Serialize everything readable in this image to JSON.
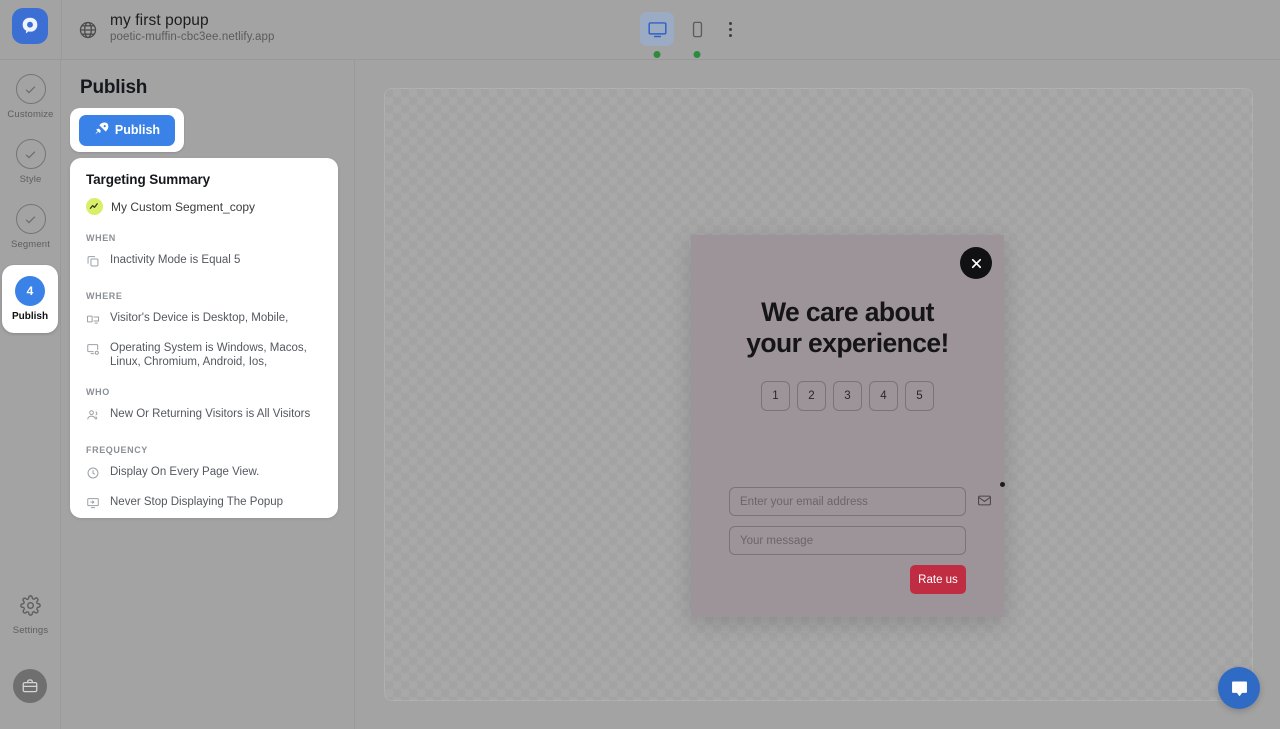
{
  "header": {
    "logo_icon": "popupsmart-logo-icon",
    "globe_icon": "globe-icon",
    "title": "my first popup",
    "url": "poetic-muffin-cbc3ee.netlify.app",
    "devices": [
      {
        "name": "desktop",
        "icon": "desktop-icon",
        "active": true,
        "status": "online"
      },
      {
        "name": "mobile",
        "icon": "mobile-icon",
        "active": false,
        "status": "online"
      }
    ],
    "menu_icon": "kebab-menu-icon",
    "active_color": "#3b6fd4",
    "status_dot_color": "#2e8b3d"
  },
  "rail": {
    "steps": [
      {
        "label": "Customize",
        "icon": "check-icon",
        "state": "complete"
      },
      {
        "label": "Style",
        "icon": "check-icon",
        "state": "complete"
      },
      {
        "label": "Segment",
        "icon": "check-icon",
        "state": "complete"
      }
    ],
    "active_step": {
      "number": "4",
      "label": "Publish",
      "color": "#3b82e8"
    },
    "settings": {
      "label": "Settings",
      "icon": "gear-icon"
    },
    "bag": {
      "icon": "briefcase-icon"
    }
  },
  "panel": {
    "title": "Publish",
    "publish_button": {
      "label": "Publish",
      "icon": "rocket-icon",
      "color": "#3b82e8"
    },
    "summary": {
      "title": "Targeting Summary",
      "segment": {
        "name": "My Custom Segment_copy",
        "icon": "trend-line-icon",
        "chip_color": "#d8ef6a"
      },
      "sections": [
        {
          "heading": "WHEN",
          "rules": [
            {
              "icon": "copy-icon",
              "text": "Inactivity Mode is Equal 5"
            }
          ]
        },
        {
          "heading": "WHERE",
          "rules": [
            {
              "icon": "device-icon",
              "text": "Visitor's Device is Desktop, Mobile,"
            },
            {
              "icon": "monitor-settings-icon",
              "text": "Operating System is Windows, Macos, Linux, Chromium, Android, Ios,"
            }
          ]
        },
        {
          "heading": "WHO",
          "rules": [
            {
              "icon": "users-icon",
              "text": "New Or Returning Visitors is All Visitors"
            }
          ]
        },
        {
          "heading": "FREQUENCY",
          "rules": [
            {
              "icon": "clock-icon",
              "text": "Display On Every Page View."
            },
            {
              "icon": "monitor-popup-icon",
              "text": "Never Stop Displaying The Popup"
            }
          ]
        }
      ]
    }
  },
  "canvas": {
    "popup": {
      "background_color": "#9c9499",
      "close_icon": "close-icon",
      "heading_line1": "We care about",
      "heading_line2": "your experience!",
      "rating_options": [
        "1",
        "2",
        "3",
        "4",
        "5"
      ],
      "email_placeholder": "Enter your email address",
      "email_value": "",
      "email_icon": "envelope-icon",
      "message_placeholder": "Your message",
      "message_value": "",
      "submit_label": "Rate us",
      "submit_color": "#c02c42"
    },
    "chat_bubble": {
      "icon": "chat-bubble-icon",
      "color": "#2f6bc4"
    }
  }
}
